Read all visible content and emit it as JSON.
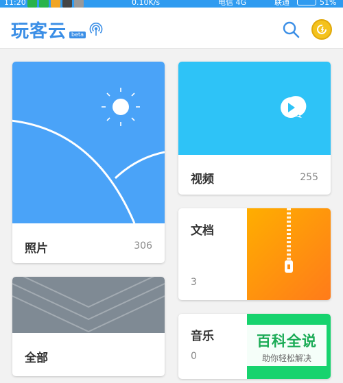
{
  "statusbar": {
    "time": "11:20",
    "speed": "0.10K/s",
    "carrier1": "电信 4G",
    "carrier2": "联通",
    "battery": "51%"
  },
  "header": {
    "title": "玩客云",
    "badge": "beta",
    "accent_color": "#3a8ee6",
    "icons": [
      "broadcast-icon",
      "search-icon",
      "coin-icon"
    ]
  },
  "cards": {
    "photos": {
      "label": "照片",
      "count": "306",
      "cover_color": "#4aa3f8"
    },
    "videos": {
      "label": "视频",
      "count": "255",
      "cover_color": "#2ec3f7"
    },
    "docs": {
      "label": "文档",
      "count": "3",
      "cover_color": "#ff9a0c"
    },
    "all": {
      "label": "全部",
      "cover_color": "#7f8a94"
    },
    "music": {
      "label": "音乐",
      "count": "0",
      "cover_color": "#17d36e"
    }
  },
  "watermark": {
    "title": "百科全说",
    "subtitle": "助你轻松解决"
  }
}
